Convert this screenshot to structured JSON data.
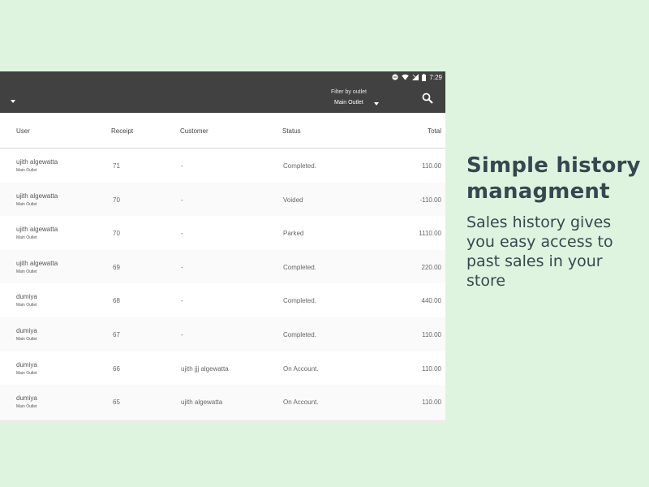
{
  "status_bar": {
    "time": "7:29",
    "icons": [
      "minus-circle-icon",
      "wifi-icon",
      "signal-icon",
      "battery-icon"
    ]
  },
  "app_bar": {
    "filter": {
      "label": "Filter by outlet",
      "value": "Main Outlet"
    },
    "icons": [
      "dropdown-caret-icon",
      "search-icon"
    ]
  },
  "table": {
    "columns": {
      "user": "User",
      "receipt": "Receipt",
      "customer": "Customer",
      "status": "Status",
      "total": "Total"
    },
    "rows": [
      {
        "user": "ujith algewatta",
        "outlet": "Main Outlet",
        "receipt": "71",
        "customer": "-",
        "status": "Completed.",
        "total": "110.00"
      },
      {
        "user": "ujith algewatta",
        "outlet": "Main Outlet",
        "receipt": "70",
        "customer": "-",
        "status": "Voided",
        "total": "-110.00"
      },
      {
        "user": "ujith algewatta",
        "outlet": "Main Outlet",
        "receipt": "70",
        "customer": "-",
        "status": "Parked",
        "total": "1110.00"
      },
      {
        "user": "ujith algewatta",
        "outlet": "Main Outlet",
        "receipt": "69",
        "customer": "-",
        "status": "Completed.",
        "total": "220.00"
      },
      {
        "user": "dumiya",
        "outlet": "Main Outlet",
        "receipt": "68",
        "customer": "-",
        "status": "Completed.",
        "total": "440.00"
      },
      {
        "user": "dumiya",
        "outlet": "Main Outlet",
        "receipt": "67",
        "customer": "-",
        "status": "Completed.",
        "total": "110.00"
      },
      {
        "user": "dumiya",
        "outlet": "Main Outlet",
        "receipt": "66",
        "customer": "ujith jjj algewatta",
        "status": "On Account.",
        "total": "110.00"
      },
      {
        "user": "dumiya",
        "outlet": "Main Outlet",
        "receipt": "65",
        "customer": "ujith algewatta",
        "status": "On Account.",
        "total": "110.00"
      }
    ]
  },
  "promo": {
    "title": "Simple history managment",
    "subtitle": "Sales history gives you easy access to past sales in your store"
  },
  "colors": {
    "background": "#dff4df",
    "app_bar": "#414141",
    "promo_text": "#37474f"
  }
}
